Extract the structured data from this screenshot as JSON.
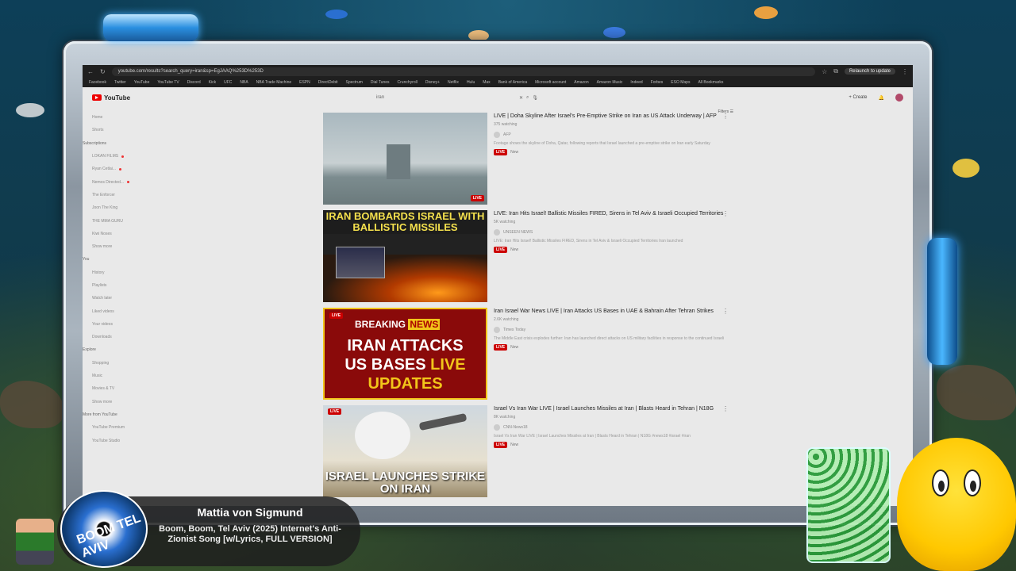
{
  "browser": {
    "url": "youtube.com/results?search_query=iran&sp=EgJAAQ%253D%253D",
    "relaunch_label": "Relaunch to update",
    "bookmarks": [
      "Facebook",
      "Twitter",
      "YouTube",
      "YouTube TV",
      "Discord",
      "Kick",
      "UFC",
      "NBA",
      "NBA Trade Machine",
      "ESPN",
      "DirectDebit",
      "Spectrum",
      "Dial Tunes",
      "Crunchyroll",
      "Disney+",
      "Netflix",
      "Hulu",
      "Max",
      "Bank of America",
      "Microsoft account",
      "Amazon",
      "Amazon Music",
      "Indeed",
      "Forbes",
      "ESO Maps",
      "All Bookmarks"
    ]
  },
  "youtube": {
    "logo_text": "YouTube",
    "search_query": "iran",
    "create_label": "Create",
    "filters_label": "Filters"
  },
  "sidebar": {
    "items": [
      {
        "label": "Home"
      },
      {
        "label": "Shorts"
      },
      {
        "label": "Subscriptions",
        "section": true
      },
      {
        "label": "LOKAN FILMS",
        "dot": true
      },
      {
        "label": "Ryan Cetlai...",
        "dot": true
      },
      {
        "label": "Nemos Directed...",
        "dot": true
      },
      {
        "label": "The Enforcer",
        "dot": false
      },
      {
        "label": "Joon The King",
        "dot": false
      },
      {
        "label": "THE MMA GURU",
        "dot": false
      },
      {
        "label": "Kiwi Noses",
        "dot": false
      },
      {
        "label": "Show more"
      },
      {
        "label": "You",
        "section": true
      },
      {
        "label": "History"
      },
      {
        "label": "Playlists"
      },
      {
        "label": "Watch later"
      },
      {
        "label": "Liked videos"
      },
      {
        "label": "Your videos"
      },
      {
        "label": "Downloads"
      },
      {
        "label": "Explore",
        "section": true
      },
      {
        "label": "Shopping"
      },
      {
        "label": "Music"
      },
      {
        "label": "Movies & TV"
      },
      {
        "label": "Show more"
      },
      {
        "label": "More from YouTube",
        "section": true
      },
      {
        "label": "YouTube Premium"
      },
      {
        "label": "YouTube Studio"
      }
    ]
  },
  "results": [
    {
      "title": "LIVE | Doha Skyline After Israel's Pre-Emptive Strike on Iran as US Attack Underway | AFP",
      "meta": "375 watching",
      "channel": "AFP",
      "desc": "Footage shows the skyline of Doha, Qatar, following reports that Israel launched a pre-emptive strike on Iran early Saturday",
      "badge": "LIVE",
      "badge2": "New"
    },
    {
      "title": "LIVE: Iran Hits Israel! Ballistic Missiles FIRED, Sirens in Tel Aviv & Israeli Occupied Territories",
      "meta": "5K watching",
      "channel": "UNSEEN NEWS",
      "desc": "LIVE: Iran Hits Israel! Ballistic Missiles FIRED, Sirens in Tel Aviv & Israeli Occupied Territories Iran launched",
      "badge": "LIVE",
      "badge2": "New",
      "thumb_text": "IRAN BOMBARDS ISRAEL WITH BALLISTIC MISSILES"
    },
    {
      "title": "Iran Israel War News LIVE | Iran Attacks US Bases in UAE & Bahrain After Tehran Strikes",
      "meta": "2.6K watching",
      "channel": "Times Today",
      "desc": "The Middle East crisis explodes further: Iran has launched direct attacks on US military facilities in response to the continued Israeli...",
      "badge": "LIVE",
      "badge2": "New",
      "thumb_live": "LIVE",
      "thumb_bn1": "BREAKING",
      "thumb_bn2": "NEWS",
      "thumb_line1": "IRAN ATTACKS",
      "thumb_line2a": "US BASES",
      "thumb_line2b": "LIVE",
      "thumb_line3": "UPDATES"
    },
    {
      "title": "Israel Vs Iran War LIVE | Israel Launches Missiles at Iran | Blasts Heard in Tehran | N18G",
      "meta": "8K watching",
      "channel": "CNN-News18",
      "desc": "Israel Vs Iran War LIVE | Israel Launches Missiles at Iran | Blasts Heard in Tehran | N18G #news18 #israel #iran",
      "badge": "LIVE",
      "badge2": "New",
      "thumb_live": "LIVE",
      "thumb_text": "ISRAEL LAUNCHES STRIKE ON IRAN"
    }
  ],
  "now_playing": {
    "album_label": "BOOM TEL AVIV",
    "artist": "Mattia von Sigmund",
    "song": "Boom, Boom, Tel Aviv (2025) Internet's Anti-Zionist Song [w/Lyrics, FULL VERSION]"
  },
  "colors": {
    "live_red": "#cc0000",
    "youtube_red": "#e00000",
    "breaking_yellow": "#f2c51a"
  }
}
